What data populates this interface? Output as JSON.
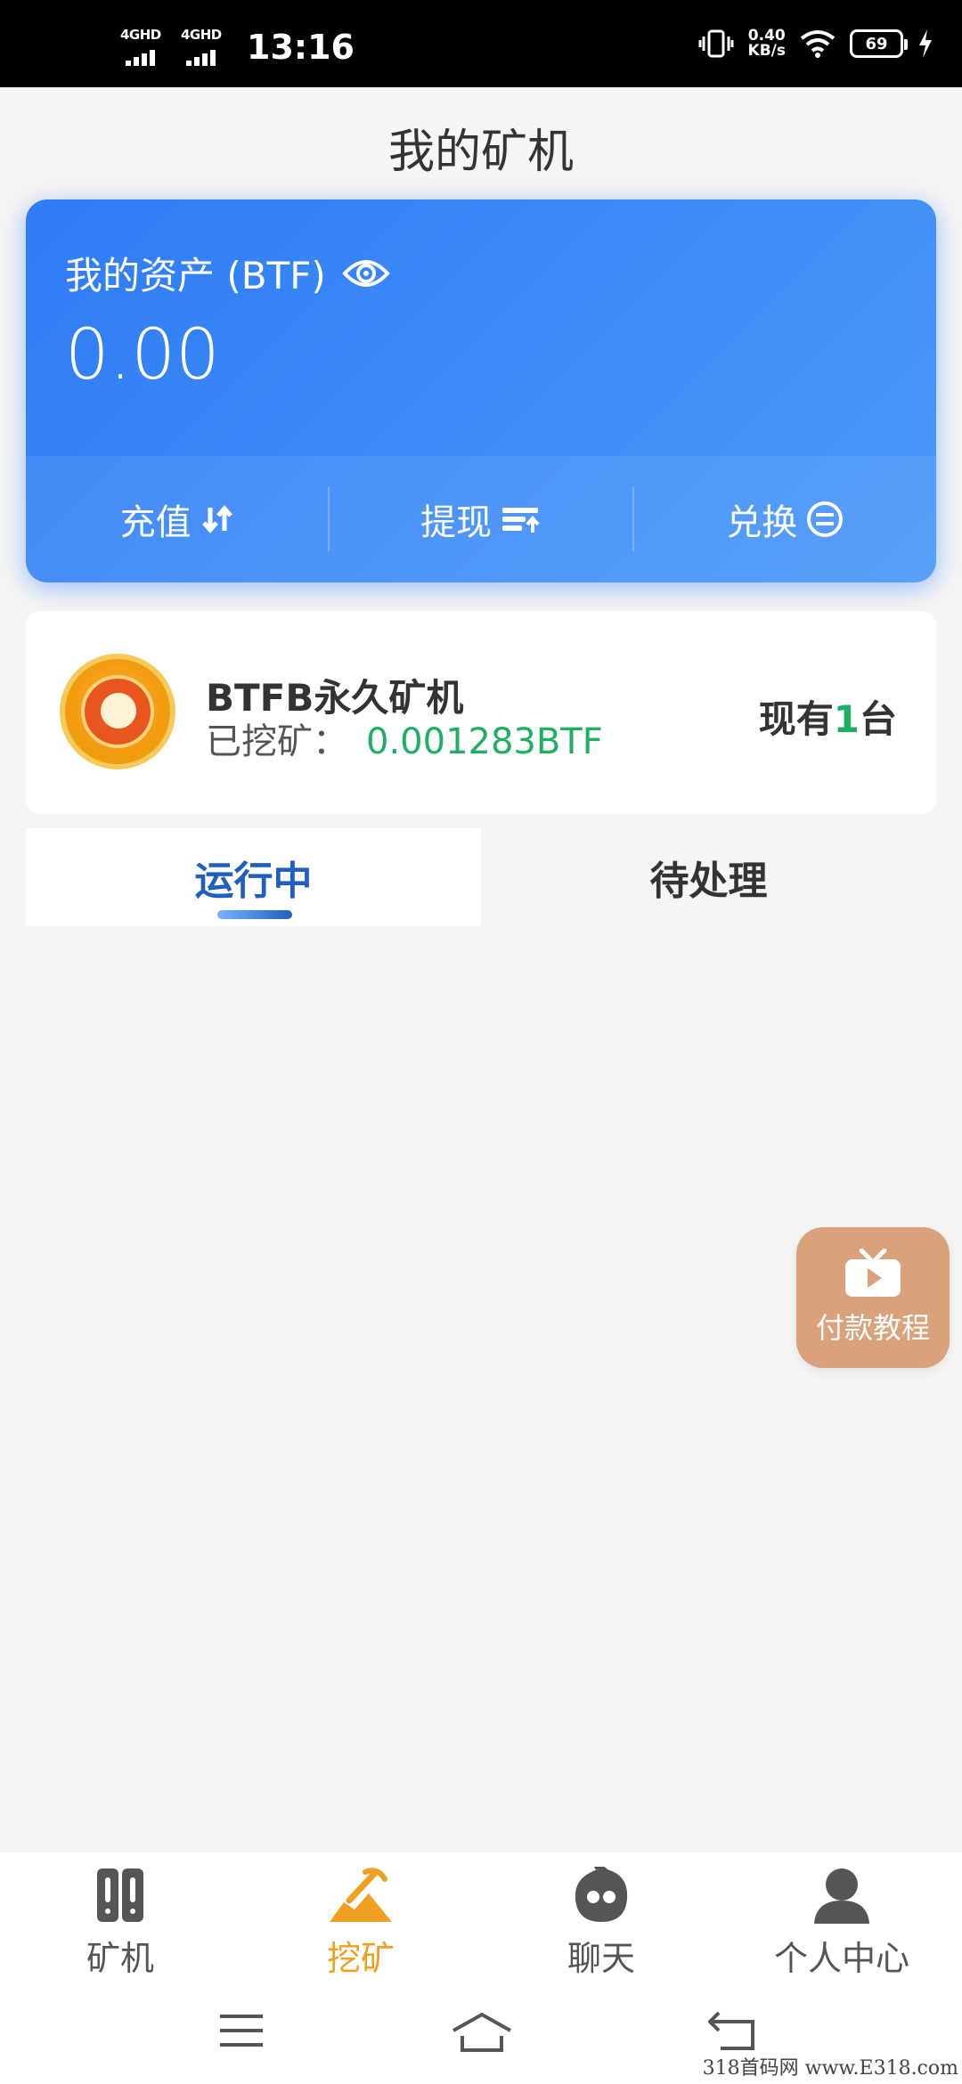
{
  "status_bar": {
    "sim1": "4GHD",
    "sim2": "4GHD",
    "time": "13:16",
    "speed_value": "0.40",
    "speed_unit": "KB/s",
    "battery": "69"
  },
  "header": {
    "title": "我的矿机"
  },
  "assets": {
    "label": "我的资产 (BTF)",
    "value": "0.00",
    "actions": [
      {
        "label": "充值",
        "icon": "transfer-arrows-icon"
      },
      {
        "label": "提现",
        "icon": "withdraw-icon"
      },
      {
        "label": "兑换",
        "icon": "exchange-icon"
      }
    ]
  },
  "machine": {
    "name": "BTFB永久矿机",
    "mined_label": "已挖矿：",
    "mined_value": "0.001283BTF",
    "count_prefix": "现有",
    "count_value": "1",
    "count_suffix": "台"
  },
  "tabs": [
    {
      "label": "运行中",
      "active": true
    },
    {
      "label": "待处理",
      "active": false
    }
  ],
  "float_button": {
    "label": "付款教程",
    "icon": "tv-play-icon"
  },
  "bottom_nav": [
    {
      "label": "矿机",
      "icon": "miner-icon",
      "active": false
    },
    {
      "label": "挖矿",
      "icon": "mining-icon",
      "active": true
    },
    {
      "label": "聊天",
      "icon": "chat-icon",
      "active": false
    },
    {
      "label": "个人中心",
      "icon": "user-icon",
      "active": false
    }
  ],
  "watermark": "318首码网 www.E318.com",
  "colors": {
    "card_blue": "#2f7bf5",
    "green": "#1fae63",
    "active_orange": "#f0a020",
    "tab_blue": "#1f5fbf",
    "float_btn": "#d9a27a"
  }
}
